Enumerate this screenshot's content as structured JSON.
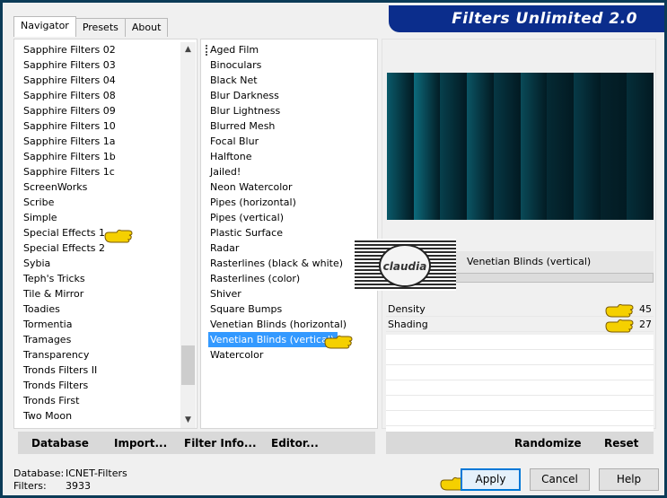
{
  "window": {
    "title": "Filters Unlimited 2.0"
  },
  "tabs": [
    "Navigator",
    "Presets",
    "About"
  ],
  "categories": [
    "Sapphire Filters 02",
    "Sapphire Filters 03",
    "Sapphire Filters 04",
    "Sapphire Filters 08",
    "Sapphire Filters 09",
    "Sapphire Filters 10",
    "Sapphire Filters 1a",
    "Sapphire Filters 1b",
    "Sapphire Filters 1c",
    "ScreenWorks",
    "Scribe",
    "Simple",
    "Special Effects 1",
    "Special Effects 2",
    "Sybia",
    "Teph's Tricks",
    "Tile & Mirror",
    "Toadies",
    "Tormentia",
    "Tramages",
    "Transparency",
    "Tronds Filters II",
    "Tronds Filters",
    "Tronds First",
    "Two Moon"
  ],
  "filters": [
    "Aged Film",
    "Binoculars",
    "Black Net",
    "Blur Darkness",
    "Blur Lightness",
    "Blurred Mesh",
    "Focal Blur",
    "Halftone",
    "Jailed!",
    "Neon Watercolor",
    "Pipes (horizontal)",
    "Pipes (vertical)",
    "Plastic Surface",
    "Radar",
    "Rasterlines (black & white)",
    "Rasterlines (color)",
    "Shiver",
    "Square Bumps",
    "Venetian Blinds (horizontal)",
    "Venetian Blinds (vertical)",
    "Watercolor"
  ],
  "selected_filter": "Venetian Blinds (vertical)",
  "filter_name": "Venetian Blinds (vertical)",
  "params": [
    {
      "label": "Density",
      "value": "45"
    },
    {
      "label": "Shading",
      "value": "27"
    }
  ],
  "watermark": "claudia",
  "toolbar": {
    "database": "Database",
    "import": "Import...",
    "filter_info": "Filter Info...",
    "editor": "Editor...",
    "randomize": "Randomize",
    "reset": "Reset"
  },
  "info": {
    "database_label": "Database:",
    "database_value": "ICNET-Filters",
    "filters_label": "Filters:",
    "filters_value": "3933"
  },
  "buttons": {
    "apply": "Apply",
    "cancel": "Cancel",
    "help": "Help"
  },
  "colors": {
    "banner": "#0b2d8c",
    "selection": "#3399ff",
    "preview": "#02222c",
    "hand": "#f5d000"
  }
}
